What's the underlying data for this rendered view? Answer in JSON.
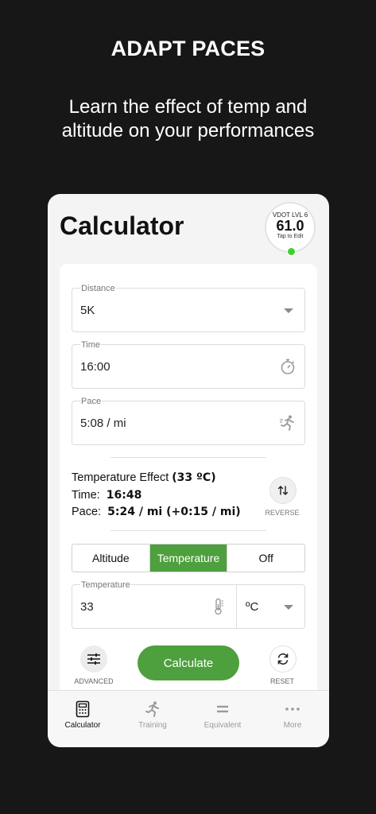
{
  "promo": {
    "title": "ADAPT PACES",
    "subtitle_line1": "Learn the effect of temp and",
    "subtitle_line2": "altitude on your performances"
  },
  "header": {
    "title": "Calculator",
    "vdot_level": "VDOT LVL 6",
    "vdot_value": "61.0",
    "vdot_hint": "Tap to Edit"
  },
  "fields": {
    "distance_label": "Distance",
    "distance_value": "5K",
    "time_label": "Time",
    "time_value": "16:00",
    "pace_label": "Pace",
    "pace_value": "5:08 / mi"
  },
  "effect": {
    "heading": "Temperature Effect",
    "heading_value": "(33 ºC)",
    "time_label": "Time:",
    "time_value": "16:48",
    "pace_label": "Pace:",
    "pace_value": "5:24 / mi (+0:15 / mi)",
    "reverse_label": "REVERSE"
  },
  "segments": [
    "Altitude",
    "Temperature",
    "Off"
  ],
  "active_segment": "Temperature",
  "temperature": {
    "label": "Temperature",
    "value": "33",
    "unit": "ºC"
  },
  "actions": {
    "advanced_label": "ADVANCED",
    "calculate_label": "Calculate",
    "reset_label": "RESET"
  },
  "tabs": [
    "Calculator",
    "Training",
    "Equivalent",
    "More"
  ],
  "colors": {
    "accent": "#4e9f3d",
    "status_dot": "#3fd12b",
    "background": "#171717"
  }
}
